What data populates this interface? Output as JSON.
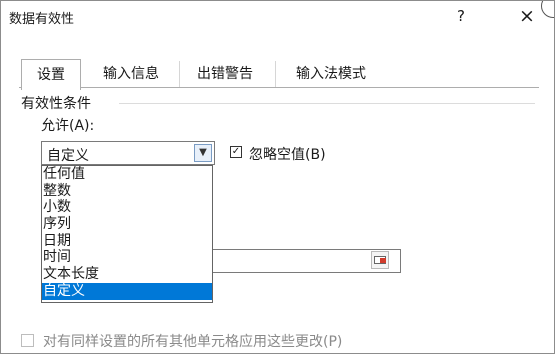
{
  "window": {
    "title": "数据有效性",
    "help_label": "?",
    "close_label": "×"
  },
  "tabs": [
    {
      "label": "设置",
      "active": true
    },
    {
      "label": "输入信息",
      "active": false
    },
    {
      "label": "出错警告",
      "active": false
    },
    {
      "label": "输入法模式",
      "active": false
    }
  ],
  "validation": {
    "section_label": "有效性条件",
    "allow_label": "允许(A):",
    "allow_value": "自定义",
    "ignore_blank_label": "忽略空值(B)",
    "ignore_blank_checked": "✓",
    "options": [
      "任何值",
      "整数",
      "小数",
      "序列",
      "日期",
      "时间",
      "文本长度",
      "自定义"
    ],
    "highlighted_option": "整数",
    "selected_option": "自定义"
  },
  "footer": {
    "apply_all_label": "对有同样设置的所有其他单元格应用这些更改(P)"
  },
  "colors": {
    "selection": "#0078d7",
    "highlight_outline": "#f06a28"
  }
}
